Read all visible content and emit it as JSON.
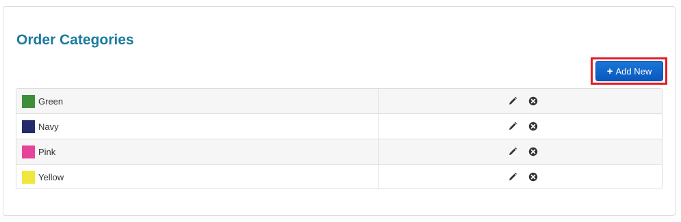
{
  "page": {
    "title": "Order Categories"
  },
  "toolbar": {
    "add_label": "Add New",
    "add_icon": "plus-icon"
  },
  "colors": {
    "title": "#1a7a9e",
    "button": "#0a58bd",
    "highlight": "#e01b24"
  },
  "categories": [
    {
      "name": "Green",
      "color": "#3f8f3a"
    },
    {
      "name": "Navy",
      "color": "#242a6b"
    },
    {
      "name": "Pink",
      "color": "#e6439a"
    },
    {
      "name": "Yellow",
      "color": "#efe73b"
    }
  ],
  "row_actions": {
    "edit_icon": "pencil-icon",
    "delete_icon": "close-circle-icon"
  }
}
